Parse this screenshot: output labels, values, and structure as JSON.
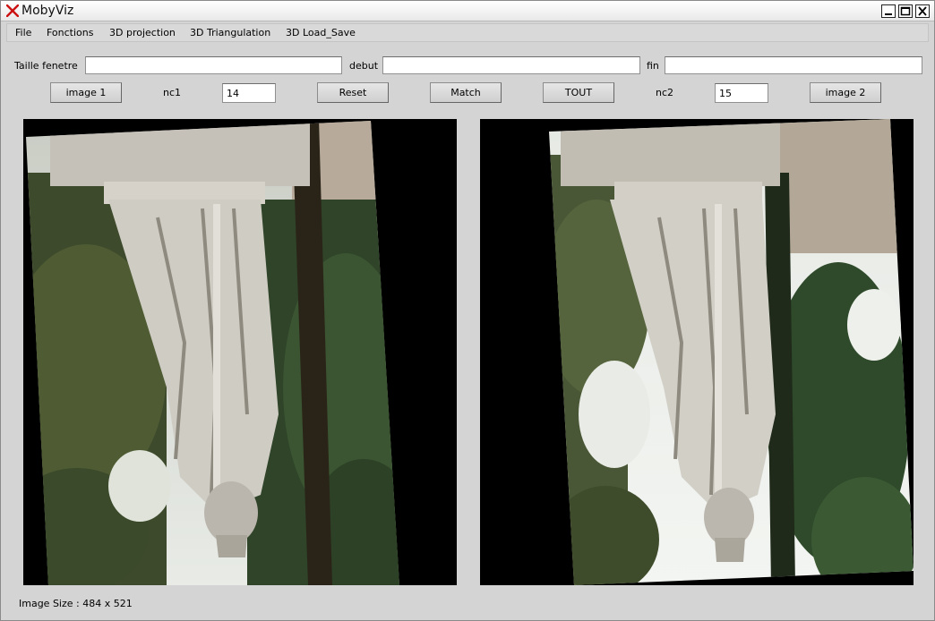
{
  "window": {
    "title": "MobyViz"
  },
  "menu": {
    "items": [
      "File",
      "Fonctions",
      "3D projection",
      "3D Triangulation",
      "3D Load_Save"
    ]
  },
  "params": {
    "taille_label": "Taille fenetre",
    "taille_value": "",
    "debut_label": "debut",
    "debut_value": "",
    "fin_label": "fin",
    "fin_value": ""
  },
  "controls": {
    "image1_label": "image 1",
    "nc1_label": "nc1",
    "nc1_value": "14",
    "reset_label": "Reset",
    "match_label": "Match",
    "tout_label": "TOUT",
    "nc2_label": "nc2",
    "nc2_value": "15",
    "image2_label": "image 2"
  },
  "status": {
    "image_size": "Image Size : 484 x 521"
  },
  "colors": {
    "background": "#d4d4d4",
    "logo_red": "#cc1111",
    "viewer_bg": "#000000"
  }
}
